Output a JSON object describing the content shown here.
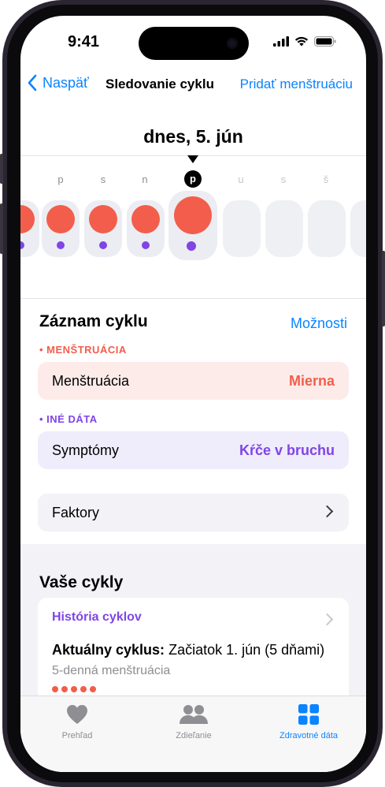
{
  "status": {
    "time": "9:41"
  },
  "nav": {
    "back_label": "Naspäť",
    "title": "Sledovanie cyklu",
    "action_label": "Pridať menštruáciu"
  },
  "calendar": {
    "date_title": "dnes, 5. jún",
    "weekdays": [
      "p",
      "s",
      "n",
      "p",
      "u",
      "s",
      "š"
    ],
    "today_index": 3
  },
  "cycle_log": {
    "title": "Záznam cyklu",
    "options_label": "Možnosti",
    "menstruation_section": "• MENŠTRUÁCIA",
    "menstruation_label": "Menštruácia",
    "menstruation_value": "Mierna",
    "other_section": "• INÉ DÁTA",
    "symptoms_label": "Symptómy",
    "symptoms_value": "Kŕče v bruchu",
    "factors_label": "Faktory"
  },
  "your_cycles": {
    "title": "Vaše cykly",
    "history_label": "História cyklov",
    "current_bold": "Aktuálny cyklus:",
    "current_value": "Začiatok 1. jún (5 dňami)",
    "period_text": "5-denná menštruácia"
  },
  "tabs": [
    {
      "label": "Prehľad",
      "icon": "heart-icon"
    },
    {
      "label": "Zdieľanie",
      "icon": "people-icon"
    },
    {
      "label": "Zdravotné dáta",
      "icon": "grid-icon"
    }
  ],
  "colors": {
    "accent": "#0a84ff",
    "menstruation": "#f25e4b",
    "other_data": "#7f45e6",
    "menstruation_row_bg": "#fdebe9",
    "symptoms_row_bg": "#efecfb"
  }
}
